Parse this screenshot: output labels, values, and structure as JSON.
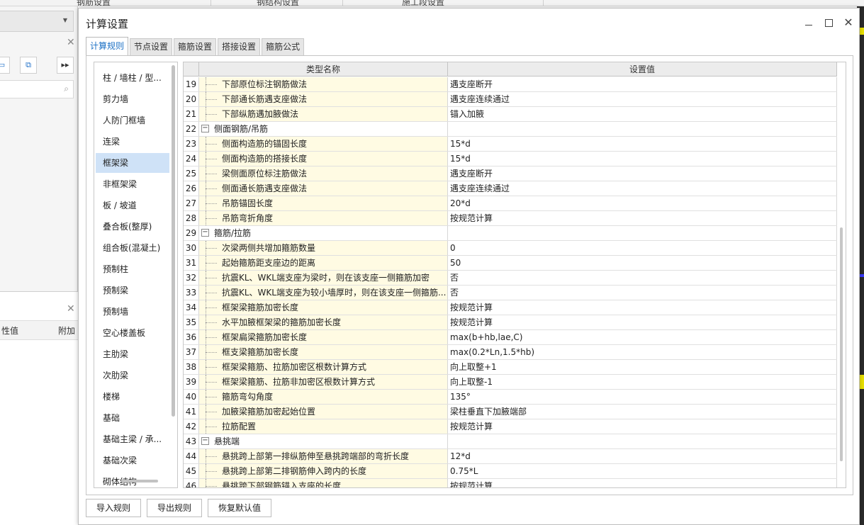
{
  "background": {
    "top_tabs": [
      "钢筋设置",
      "钢结构设置",
      "施工段设置"
    ],
    "panel_headers": [
      "性值",
      "附加"
    ],
    "toolbar_icons": [
      "panel-icon",
      "layout-icon",
      "fast-forward-icon"
    ]
  },
  "dialog": {
    "title": "计算设置",
    "tabs": [
      {
        "label": "计算规则",
        "active": true
      },
      {
        "label": "节点设置",
        "active": false
      },
      {
        "label": "箍筋设置",
        "active": false
      },
      {
        "label": "搭接设置",
        "active": false
      },
      {
        "label": "箍筋公式",
        "active": false
      }
    ],
    "categories": [
      {
        "label": "柱 / 墙柱 / 型...",
        "selected": false
      },
      {
        "label": "剪力墙",
        "selected": false
      },
      {
        "label": "人防门框墙",
        "selected": false
      },
      {
        "label": "连梁",
        "selected": false
      },
      {
        "label": "框架梁",
        "selected": true
      },
      {
        "label": "非框架梁",
        "selected": false
      },
      {
        "label": "板 / 坡道",
        "selected": false
      },
      {
        "label": "叠合板(整厚)",
        "selected": false
      },
      {
        "label": "组合板(混凝土)",
        "selected": false
      },
      {
        "label": "预制柱",
        "selected": false
      },
      {
        "label": "预制梁",
        "selected": false
      },
      {
        "label": "预制墙",
        "selected": false
      },
      {
        "label": "空心楼盖板",
        "selected": false
      },
      {
        "label": "主肋梁",
        "selected": false
      },
      {
        "label": "次肋梁",
        "selected": false
      },
      {
        "label": "楼梯",
        "selected": false
      },
      {
        "label": "基础",
        "selected": false
      },
      {
        "label": "基础主梁 / 承...",
        "selected": false
      },
      {
        "label": "基础次梁",
        "selected": false
      },
      {
        "label": "砌体结构",
        "selected": false
      }
    ],
    "grid": {
      "headers": {
        "name": "类型名称",
        "value": "设置值"
      },
      "rows": [
        {
          "num": "19",
          "name": "下部原位标注钢筋做法",
          "value": "遇支座断开",
          "group": false
        },
        {
          "num": "20",
          "name": "下部通长筋遇支座做法",
          "value": "遇支座连续通过",
          "group": false
        },
        {
          "num": "21",
          "name": "下部纵筋遇加腋做法",
          "value": "锚入加腋",
          "group": false
        },
        {
          "num": "22",
          "name": "侧面钢筋/吊筋",
          "value": "",
          "group": true
        },
        {
          "num": "23",
          "name": "侧面构造筋的锚固长度",
          "value": "15*d",
          "group": false
        },
        {
          "num": "24",
          "name": "侧面构造筋的搭接长度",
          "value": "15*d",
          "group": false
        },
        {
          "num": "25",
          "name": "梁侧面原位标注筋做法",
          "value": "遇支座断开",
          "group": false
        },
        {
          "num": "26",
          "name": "侧面通长筋遇支座做法",
          "value": "遇支座连续通过",
          "group": false
        },
        {
          "num": "27",
          "name": "吊筋锚固长度",
          "value": "20*d",
          "group": false
        },
        {
          "num": "28",
          "name": "吊筋弯折角度",
          "value": "按规范计算",
          "group": false
        },
        {
          "num": "29",
          "name": "箍筋/拉筋",
          "value": "",
          "group": true
        },
        {
          "num": "30",
          "name": "次梁两侧共增加箍筋数量",
          "value": "0",
          "group": false
        },
        {
          "num": "31",
          "name": "起始箍筋距支座边的距离",
          "value": "50",
          "group": false
        },
        {
          "num": "32",
          "name": "抗震KL、WKL端支座为梁时，则在该支座一侧箍筋加密",
          "value": "否",
          "group": false
        },
        {
          "num": "33",
          "name": "抗震KL、WKL端支座为较小墙厚时，则在该支座一侧箍筋...",
          "value": "否",
          "group": false
        },
        {
          "num": "34",
          "name": "框架梁箍筋加密长度",
          "value": "按规范计算",
          "group": false
        },
        {
          "num": "35",
          "name": "水平加腋框架梁的箍筋加密长度",
          "value": "按规范计算",
          "group": false
        },
        {
          "num": "36",
          "name": "框架扁梁箍筋加密长度",
          "value": "max(b+hb,lae,C)",
          "group": false
        },
        {
          "num": "37",
          "name": "框支梁箍筋加密长度",
          "value": "max(0.2*Ln,1.5*hb)",
          "group": false
        },
        {
          "num": "38",
          "name": "框架梁箍筋、拉筋加密区根数计算方式",
          "value": "向上取整+1",
          "group": false
        },
        {
          "num": "39",
          "name": "框架梁箍筋、拉筋非加密区根数计算方式",
          "value": "向上取整-1",
          "group": false
        },
        {
          "num": "40",
          "name": "箍筋弯勾角度",
          "value": "135°",
          "group": false
        },
        {
          "num": "41",
          "name": "加腋梁箍筋加密起始位置",
          "value": "梁柱垂直下加腋端部",
          "group": false
        },
        {
          "num": "42",
          "name": "拉筋配置",
          "value": "按规范计算",
          "group": false
        },
        {
          "num": "43",
          "name": "悬挑端",
          "value": "",
          "group": true
        },
        {
          "num": "44",
          "name": "悬挑跨上部第一排纵筋伸至悬挑跨端部的弯折长度",
          "value": "12*d",
          "group": false
        },
        {
          "num": "45",
          "name": "悬挑跨上部第二排钢筋伸入跨内的长度",
          "value": "0.75*L",
          "group": false
        },
        {
          "num": "46",
          "name": "悬挑跨下部钢筋锚入支座的长度",
          "value": "按规范计算",
          "group": false
        }
      ]
    },
    "footer": {
      "import": "导入规则",
      "export": "导出规则",
      "restore": "恢复默认值"
    }
  },
  "colors": {
    "accent": "#1a6fc4",
    "name_cell_bg": "#fffbe3",
    "selected_bg": "#cfe2f7"
  }
}
